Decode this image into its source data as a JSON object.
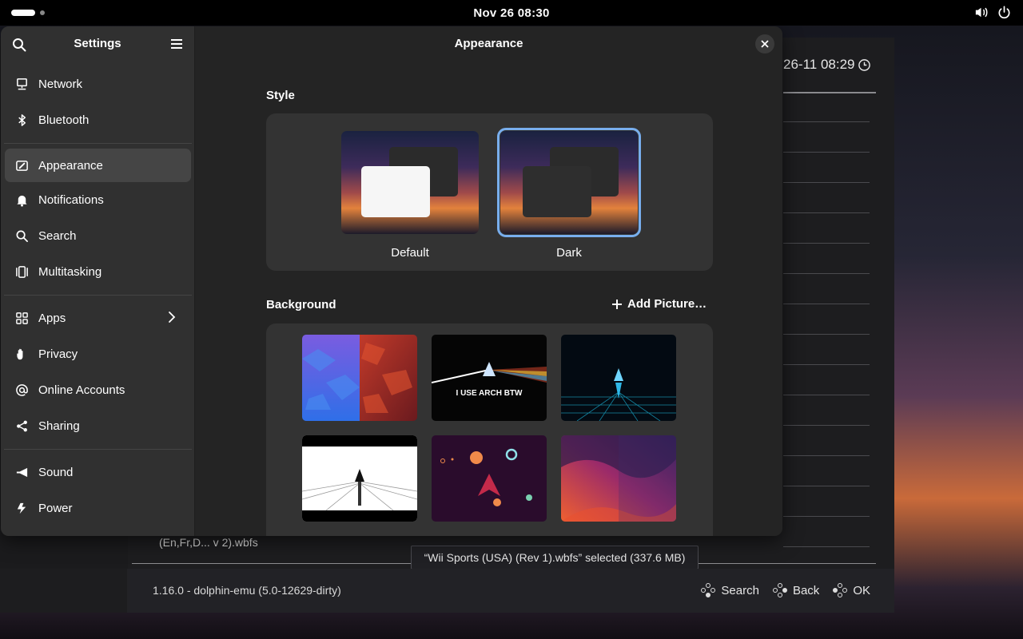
{
  "topbar": {
    "clock": "Nov 26  08:30",
    "icons": [
      "volume-icon",
      "power-icon"
    ]
  },
  "background_app": {
    "datetime": "26-11 08:29",
    "game_name": "(En,Fr,D...  v 2).wbfs",
    "status_message": "“Wii Sports (USA) (Rev 1).wbfs” selected  (337.6 MB)",
    "version": "1.16.0 - dolphin-emu (5.0-12629-dirty)",
    "footer_buttons": [
      "Search",
      "Back",
      "OK"
    ]
  },
  "settings": {
    "sidebar": {
      "title": "Settings",
      "groups": [
        [
          {
            "label": "Network",
            "icon": "network-icon"
          },
          {
            "label": "Bluetooth",
            "icon": "bluetooth-icon"
          }
        ],
        [
          {
            "label": "Appearance",
            "icon": "appearance-icon",
            "active": true
          },
          {
            "label": "Notifications",
            "icon": "bell-icon"
          },
          {
            "label": "Search",
            "icon": "search-icon"
          },
          {
            "label": "Multitasking",
            "icon": "multitasking-icon"
          }
        ],
        [
          {
            "label": "Apps",
            "icon": "apps-icon",
            "chevron": true
          },
          {
            "label": "Privacy",
            "icon": "hand-icon"
          },
          {
            "label": "Online Accounts",
            "icon": "at-icon"
          },
          {
            "label": "Sharing",
            "icon": "share-icon"
          }
        ],
        [
          {
            "label": "Sound",
            "icon": "speaker-icon"
          },
          {
            "label": "Power",
            "icon": "power-icon"
          }
        ]
      ]
    },
    "main": {
      "title": "Appearance",
      "style_label": "Style",
      "style_options": [
        {
          "label": "Default",
          "selected": false
        },
        {
          "label": "Dark",
          "selected": true
        }
      ],
      "background_label": "Background",
      "add_picture": "Add Picture…",
      "wallpaper_text": "I USE ARCH BTW"
    }
  },
  "colors": {
    "accent": "#78aeed",
    "sidebar_bg": "#303030",
    "window_bg": "#242424",
    "card_bg": "#333333"
  }
}
